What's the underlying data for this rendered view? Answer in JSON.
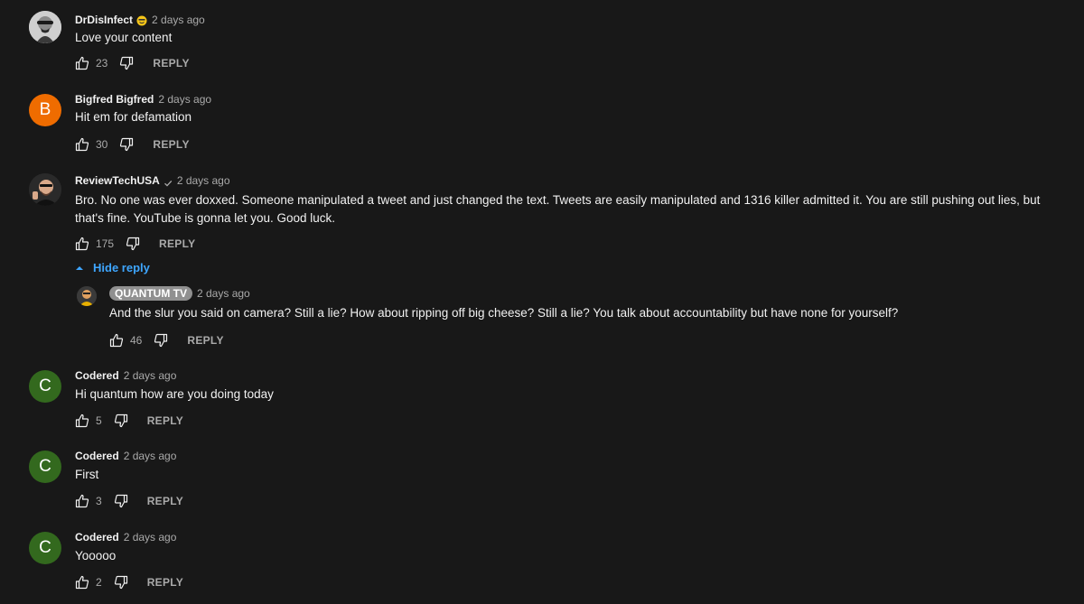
{
  "hide_reply_label": "Hide reply",
  "reply_label": "REPLY",
  "comments": [
    {
      "author": "DrDisInfect",
      "author_badge": "smiley-emoji",
      "time": "2 days ago",
      "text": "Love your content",
      "likes": "23"
    },
    {
      "author": "Bigfred Bigfred",
      "avatar_letter": "B",
      "avatar_color": "#ef6c00",
      "time": "2 days ago",
      "text": "Hit em for defamation",
      "likes": "30"
    },
    {
      "author": "ReviewTechUSA",
      "author_badge": "verified-check",
      "time": "2 days ago",
      "text": "Bro. No one was ever doxxed. Someone manipulated a tweet and just changed the text. Tweets are easily manipulated and 1316 killer admitted it. You are still pushing out lies, but that's fine. YouTube is gonna let you. Good luck.",
      "likes": "175"
    },
    {
      "author": "QUANTUM TV",
      "is_channel_owner": true,
      "time": "2 days ago",
      "text": "And the slur you said on camera? Still a lie? How about ripping off big cheese? Still a lie? You talk about accountability but have none for yourself?",
      "likes": "46"
    },
    {
      "author": "Codered",
      "avatar_letter": "C",
      "avatar_color": "#33691e",
      "time": "2 days ago",
      "text": "Hi quantum how are you doing today",
      "likes": "5"
    },
    {
      "author": "Codered",
      "avatar_letter": "C",
      "avatar_color": "#33691e",
      "time": "2 days ago",
      "text": "First",
      "likes": "3"
    },
    {
      "author": "Codered",
      "avatar_letter": "C",
      "avatar_color": "#33691e",
      "time": "2 days ago",
      "text": "Yooooo",
      "likes": "2"
    }
  ]
}
